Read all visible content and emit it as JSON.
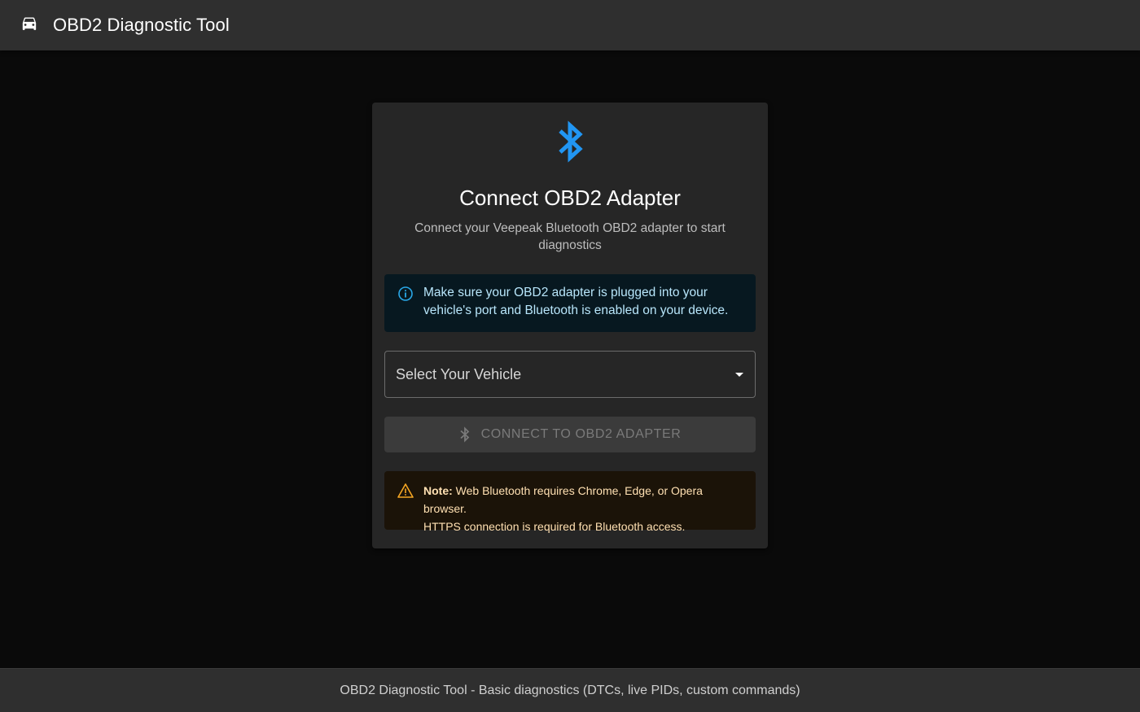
{
  "header": {
    "title": "OBD2 Diagnostic Tool",
    "icon": "car-icon"
  },
  "card": {
    "hero_icon": "bluetooth-icon",
    "hero_color": "#2196f3",
    "title": "Connect OBD2 Adapter",
    "subtitle": "Connect your Veepeak Bluetooth OBD2 adapter to start diagnostics",
    "info_alert": {
      "icon": "info-icon",
      "text": "Make sure your OBD2 adapter is plugged into your vehicle's port and Bluetooth is enabled on your device."
    },
    "vehicle_select": {
      "label": "Select Your Vehicle",
      "icon": "chevron-down-icon"
    },
    "connect_button": {
      "label": "CONNECT TO OBD2 ADAPTER",
      "icon": "bluetooth-icon",
      "disabled": true
    },
    "warning_alert": {
      "icon": "warning-icon",
      "note_label": "Note:",
      "text_line1": "Web Bluetooth requires Chrome, Edge, or Opera browser.",
      "text_line2": "HTTPS connection is required for Bluetooth access."
    }
  },
  "footer": {
    "text": "OBD2 Diagnostic Tool - Basic diagnostics (DTCs, live PIDs, custom commands)"
  },
  "colors": {
    "background": "#0a0a0a",
    "appbar": "#2f2f2f",
    "card": "#262626",
    "accent_blue": "#2196f3",
    "info_text": "#b8e6fb",
    "warning_orange": "#f5a623",
    "warning_text": "#ffe0b2"
  }
}
